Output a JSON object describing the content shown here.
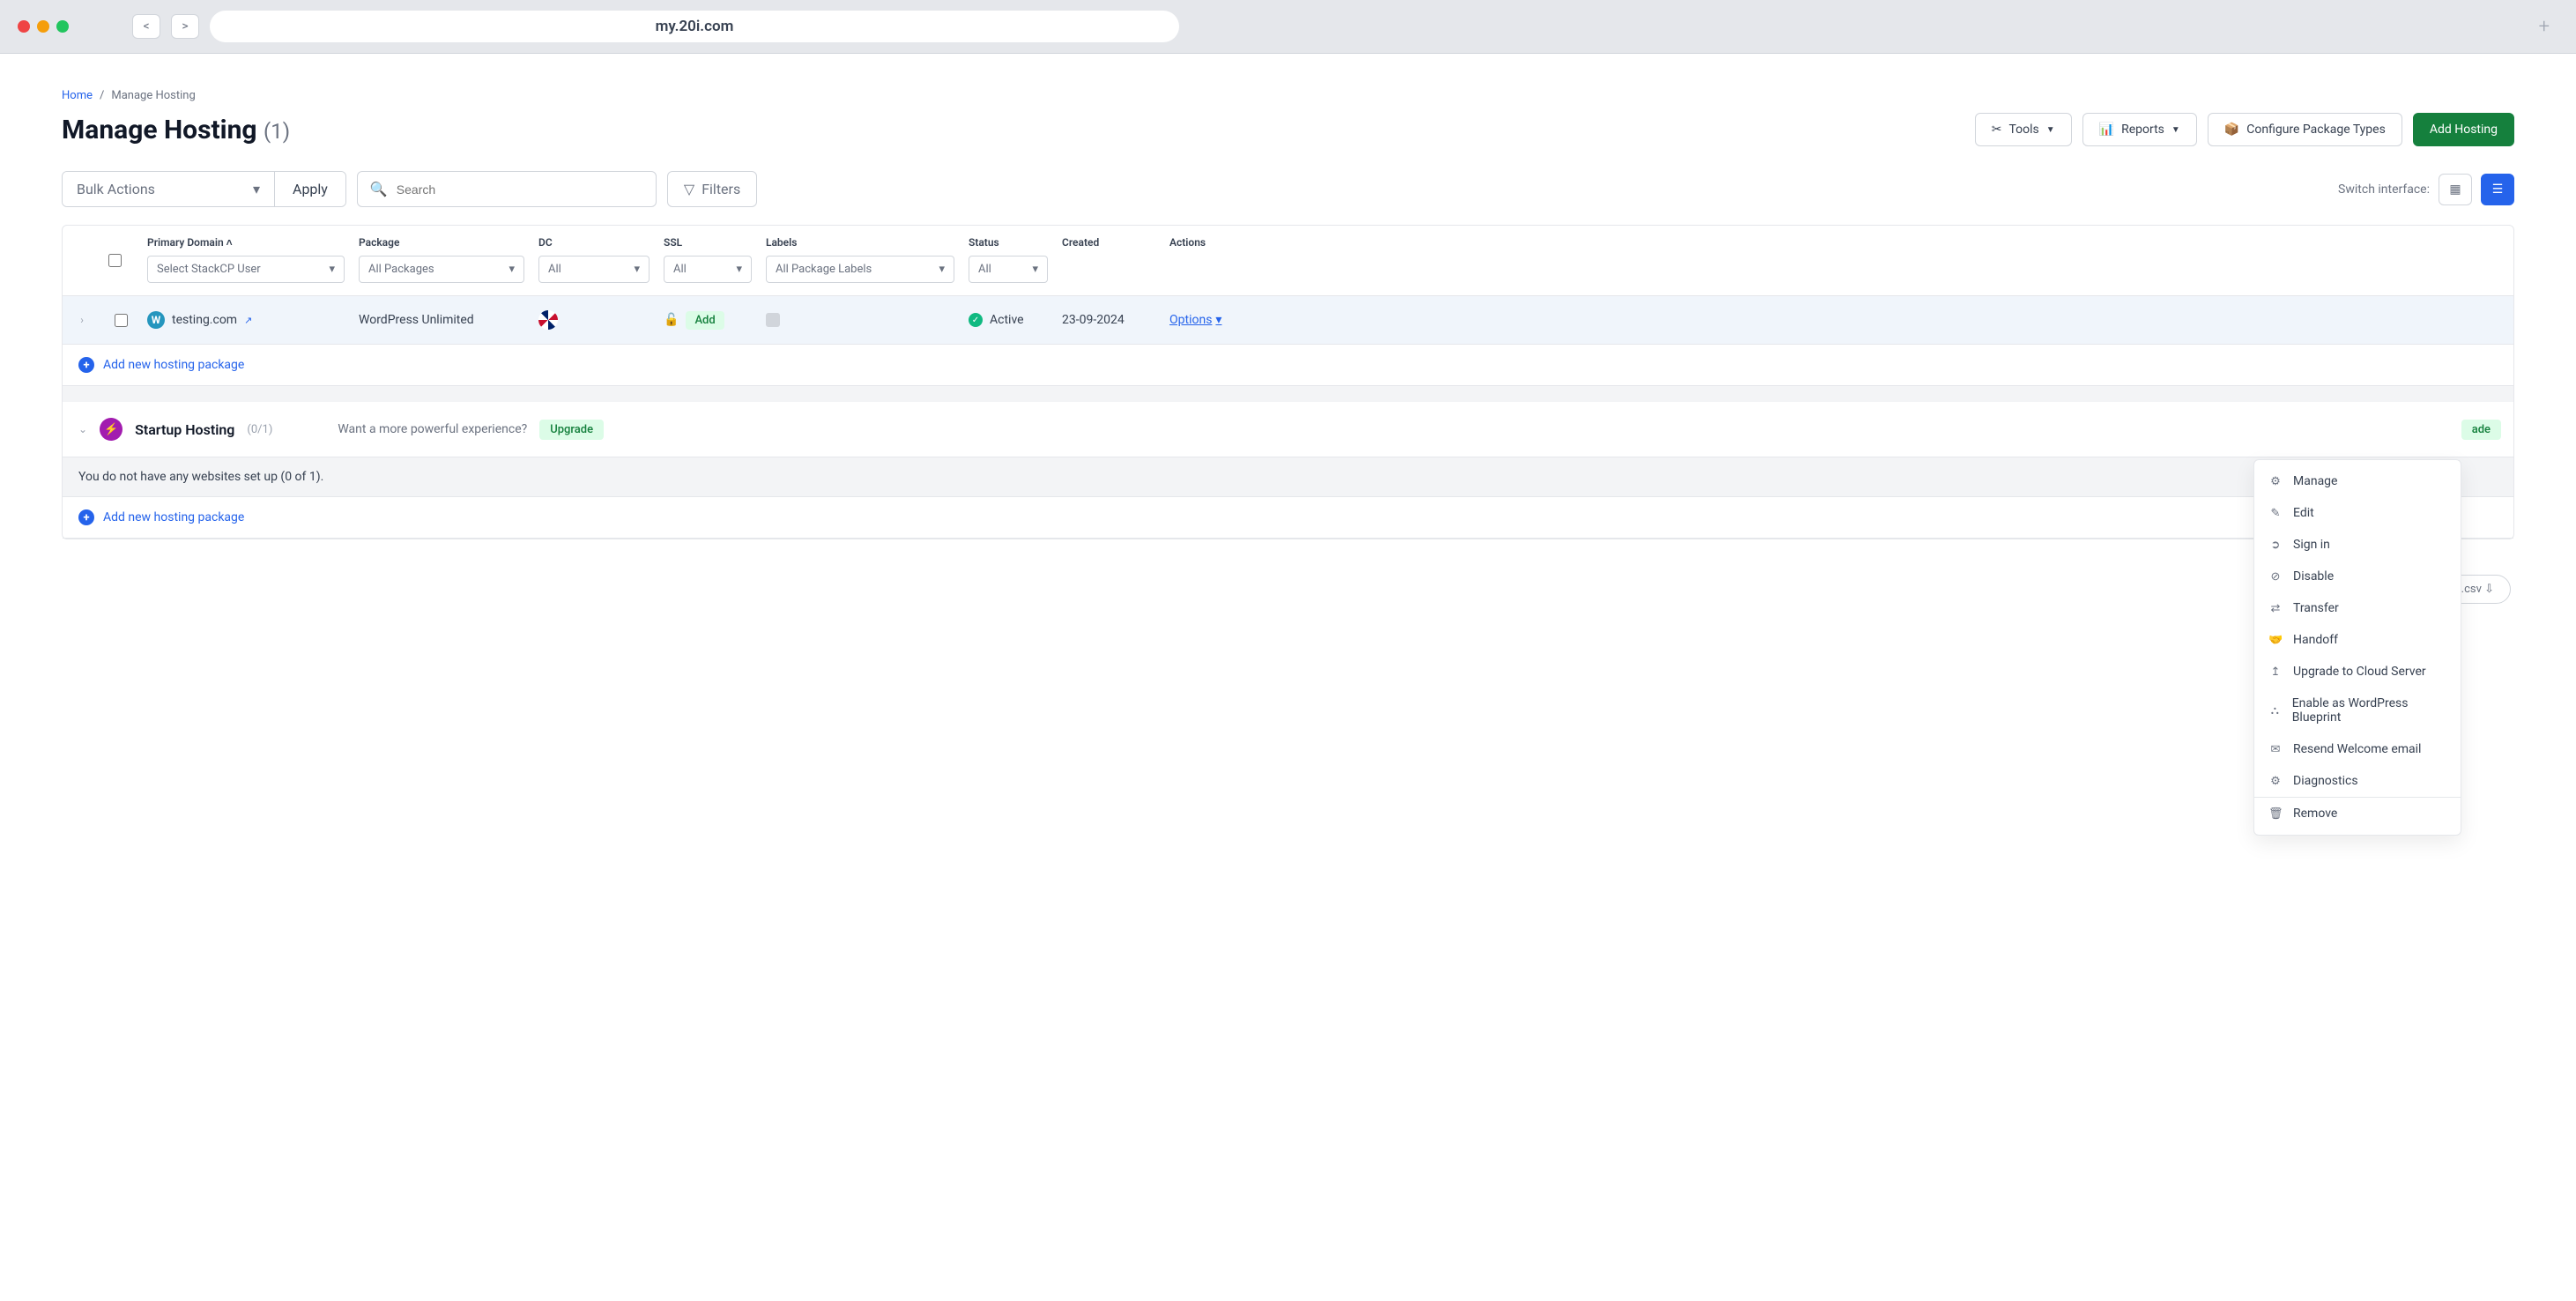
{
  "browser": {
    "url": "my.20i.com",
    "back": "<",
    "forward": ">",
    "add_tab": "+"
  },
  "breadcrumb": {
    "home": "Home",
    "sep": "/",
    "current": "Manage Hosting"
  },
  "title": {
    "text": "Manage Hosting",
    "count": "(1)"
  },
  "top_actions": {
    "tools": "Tools",
    "reports": "Reports",
    "configure": "Configure Package Types",
    "add_hosting": "Add Hosting"
  },
  "filters_row": {
    "bulk_label": "Bulk Actions",
    "apply": "Apply",
    "search_placeholder": "Search",
    "filters": "Filters",
    "switch_label": "Switch interface:"
  },
  "columns": {
    "primary": {
      "label": "Primary Domain",
      "select": "Select StackCP User"
    },
    "package": {
      "label": "Package",
      "select": "All Packages"
    },
    "dc": {
      "label": "DC",
      "select": "All"
    },
    "ssl": {
      "label": "SSL",
      "select": "All"
    },
    "labels": {
      "label": "Labels",
      "select": "All Package Labels"
    },
    "status": {
      "label": "Status",
      "select": "All"
    },
    "created": {
      "label": "Created"
    },
    "actions": {
      "label": "Actions"
    }
  },
  "row": {
    "domain": "testing.com",
    "package": "WordPress Unlimited",
    "ssl_add": "Add",
    "status_text": "Active",
    "created": "23-09-2024",
    "options": "Options"
  },
  "add_package": "Add new hosting package",
  "startup": {
    "title": "Startup Hosting",
    "count": "(0/1)",
    "question": "Want a more powerful experience?",
    "upgrade": "Upgrade",
    "empty": "You do not have any websites set up (0 of 1).",
    "right_badge": "ade"
  },
  "csv": ".csv ⇩",
  "dropdown": {
    "manage": "Manage",
    "edit": "Edit",
    "signin": "Sign in",
    "disable": "Disable",
    "transfer": "Transfer",
    "handoff": "Handoff",
    "upgrade": "Upgrade to Cloud Server",
    "blueprint": "Enable as WordPress Blueprint",
    "resend": "Resend Welcome email",
    "diagnostics": "Diagnostics",
    "remove": "Remove"
  }
}
